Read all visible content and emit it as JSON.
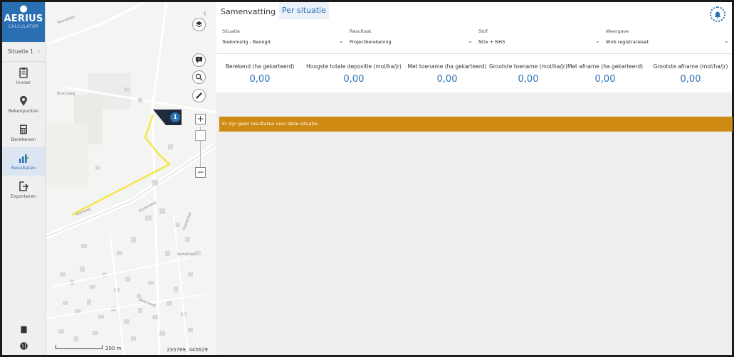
{
  "nav": {
    "logo_name": "AERIUS",
    "logo_sub": "CALCULATOR",
    "situation_selector": "Situatie 1",
    "items": [
      {
        "label": "Invoer",
        "icon": "clipboard-icon"
      },
      {
        "label": "Rekenpunten",
        "icon": "map-pin-icon"
      },
      {
        "label": "Berekenen",
        "icon": "calculator-icon"
      },
      {
        "label": "Resultaten",
        "icon": "results-chart-icon"
      },
      {
        "label": "Exporteren",
        "icon": "export-icon"
      }
    ]
  },
  "map": {
    "marker_label": "1",
    "scale_label": "200 m",
    "coordinates": "235789, 445629",
    "street_names": [
      "Hoevelaan",
      "Boschweg",
      "Zuiderweg",
      "Ooststraat",
      "Kerkstraat",
      "Molenweg",
      "Rijksweg"
    ]
  },
  "tabs": {
    "summary": "Samenvatting",
    "per_situation": "Per situatie"
  },
  "filters": {
    "situation": {
      "label": "Situatie",
      "value": "Toekomstig - Beoogd"
    },
    "result": {
      "label": "Resultaat",
      "value": "Projectberekening"
    },
    "substance": {
      "label": "Stof",
      "value": "NOx + NH3"
    },
    "view": {
      "label": "Weergave",
      "value": "Wnb registratieset"
    }
  },
  "stats": [
    {
      "label": "Berekend (ha gekarteerd)",
      "value": "0,00"
    },
    {
      "label": "Hoogste totale depositie (mol/ha/jr)",
      "value": "0,00"
    },
    {
      "label": "Met toename (ha gekarteerd)",
      "value": "0,00"
    },
    {
      "label": "Grootste toename (mol/ha/jr)",
      "value": "0,00"
    },
    {
      "label": "Met afname (ha gekarteerd)",
      "value": "0,00"
    },
    {
      "label": "Grootste afname (mol/ha/jr)",
      "value": "0,00"
    }
  ],
  "warning": "Er zijn geen resultaten voor deze situatie.",
  "colors": {
    "brand_blue": "#2b6fb3",
    "warning_orange": "#cf8a13",
    "route_yellow": "#f2e84a"
  }
}
